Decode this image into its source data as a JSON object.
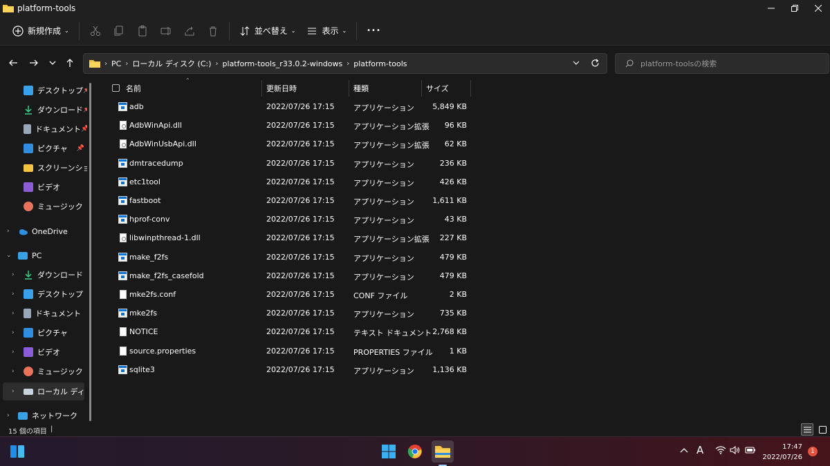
{
  "window": {
    "title": "platform-tools"
  },
  "toolbar": {
    "new_label": "新規作成",
    "sort_label": "並べ替え",
    "view_label": "表示",
    "more_label": "•••"
  },
  "address": {
    "crumbs": [
      "PC",
      "ローカル ディスク (C:)",
      "platform-tools_r33.0.2-windows",
      "platform-tools"
    ]
  },
  "search": {
    "placeholder": "platform-toolsの検索"
  },
  "sidebar": {
    "items": [
      {
        "label": "デスクトップ",
        "icon": "desktop-icon",
        "pinned": true
      },
      {
        "label": "ダウンロード",
        "icon": "download-icon",
        "pinned": true
      },
      {
        "label": "ドキュメント",
        "icon": "document-icon",
        "pinned": true
      },
      {
        "label": "ピクチャ",
        "icon": "picture-icon",
        "pinned": true
      },
      {
        "label": "スクリーンショット",
        "icon": "folder-icon",
        "pinned": false
      },
      {
        "label": "ビデオ",
        "icon": "video-icon",
        "pinned": false
      },
      {
        "label": "ミュージック",
        "icon": "music-icon",
        "pinned": false
      },
      {
        "label": "OneDrive",
        "icon": "onedrive-icon"
      },
      {
        "label": "PC",
        "icon": "pc-icon"
      },
      {
        "label": "ダウンロード",
        "icon": "download-icon"
      },
      {
        "label": "デスクトップ",
        "icon": "desktop-icon"
      },
      {
        "label": "ドキュメント",
        "icon": "document-icon"
      },
      {
        "label": "ピクチャ",
        "icon": "picture-icon"
      },
      {
        "label": "ビデオ",
        "icon": "video-icon"
      },
      {
        "label": "ミュージック",
        "icon": "music-icon"
      },
      {
        "label": "ローカル ディスク (",
        "icon": "drive-icon"
      },
      {
        "label": "ネットワーク",
        "icon": "network-icon"
      }
    ]
  },
  "columns": {
    "name": "名前",
    "date": "更新日時",
    "type": "種類",
    "size": "サイズ"
  },
  "files": [
    {
      "name": "adb",
      "date": "2022/07/26 17:15",
      "type": "アプリケーション",
      "size": "5,849 KB",
      "icon": "exe"
    },
    {
      "name": "AdbWinApi.dll",
      "date": "2022/07/26 17:15",
      "type": "アプリケーション拡張",
      "size": "96 KB",
      "icon": "dll"
    },
    {
      "name": "AdbWinUsbApi.dll",
      "date": "2022/07/26 17:15",
      "type": "アプリケーション拡張",
      "size": "62 KB",
      "icon": "dll"
    },
    {
      "name": "dmtracedump",
      "date": "2022/07/26 17:15",
      "type": "アプリケーション",
      "size": "236 KB",
      "icon": "exe"
    },
    {
      "name": "etc1tool",
      "date": "2022/07/26 17:15",
      "type": "アプリケーション",
      "size": "426 KB",
      "icon": "exe"
    },
    {
      "name": "fastboot",
      "date": "2022/07/26 17:15",
      "type": "アプリケーション",
      "size": "1,611 KB",
      "icon": "exe"
    },
    {
      "name": "hprof-conv",
      "date": "2022/07/26 17:15",
      "type": "アプリケーション",
      "size": "43 KB",
      "icon": "exe"
    },
    {
      "name": "libwinpthread-1.dll",
      "date": "2022/07/26 17:15",
      "type": "アプリケーション拡張",
      "size": "227 KB",
      "icon": "dll"
    },
    {
      "name": "make_f2fs",
      "date": "2022/07/26 17:15",
      "type": "アプリケーション",
      "size": "479 KB",
      "icon": "exe"
    },
    {
      "name": "make_f2fs_casefold",
      "date": "2022/07/26 17:15",
      "type": "アプリケーション",
      "size": "479 KB",
      "icon": "exe"
    },
    {
      "name": "mke2fs.conf",
      "date": "2022/07/26 17:15",
      "type": "CONF ファイル",
      "size": "2 KB",
      "icon": "doc"
    },
    {
      "name": "mke2fs",
      "date": "2022/07/26 17:15",
      "type": "アプリケーション",
      "size": "735 KB",
      "icon": "exe"
    },
    {
      "name": "NOTICE",
      "date": "2022/07/26 17:15",
      "type": "テキスト ドキュメント",
      "size": "2,768 KB",
      "icon": "doc"
    },
    {
      "name": "source.properties",
      "date": "2022/07/26 17:15",
      "type": "PROPERTIES ファイル",
      "size": "1 KB",
      "icon": "doc"
    },
    {
      "name": "sqlite3",
      "date": "2022/07/26 17:15",
      "type": "アプリケーション",
      "size": "1,136 KB",
      "icon": "exe"
    }
  ],
  "status": {
    "item_count": "15 個の項目"
  },
  "taskbar": {
    "time": "17:47",
    "date": "2022/07/26",
    "notification_count": "1",
    "ime_label": "A"
  }
}
